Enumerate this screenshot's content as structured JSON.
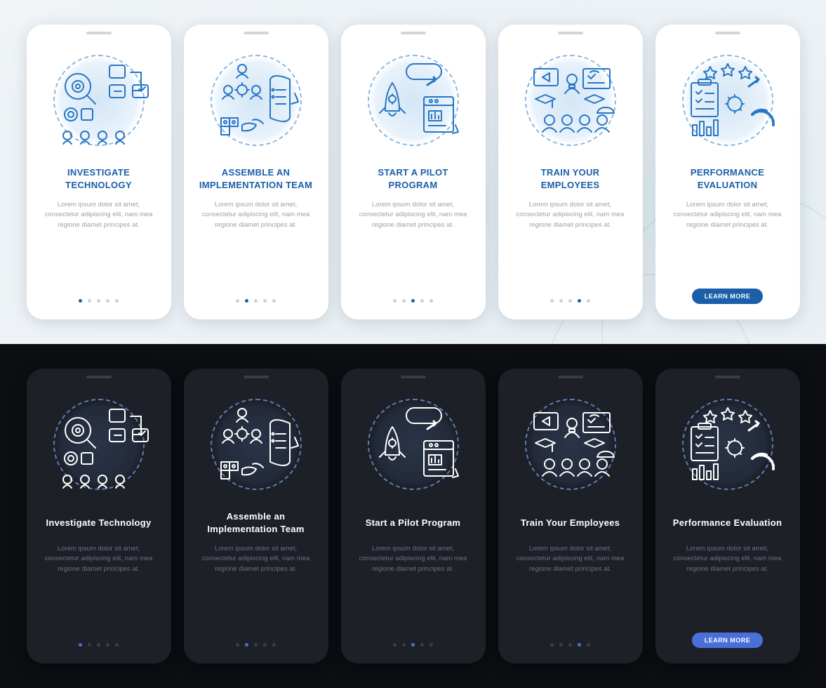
{
  "lorem": "Lorem ipsum dolor sit amet, consectetur adipiscing elit, nam mea regione diamet principes at.",
  "learn_more": "LEARN MORE",
  "cards": [
    {
      "title_light": "INVESTIGATE TECHNOLOGY",
      "title_dark": "Investigate Technology",
      "active": 0
    },
    {
      "title_light": "ASSEMBLE AN IMPLEMENTATION TEAM",
      "title_dark": "Assemble an Implementation Team",
      "active": 1
    },
    {
      "title_light": "START A PILOT PROGRAM",
      "title_dark": "Start a Pilot Program",
      "active": 2
    },
    {
      "title_light": "TRAIN YOUR EMPLOYEES",
      "title_dark": "Train Your Employees",
      "active": 3
    },
    {
      "title_light": "PERFORMANCE EVALUATION",
      "title_dark": "Performance Evaluation",
      "active": 4
    }
  ]
}
